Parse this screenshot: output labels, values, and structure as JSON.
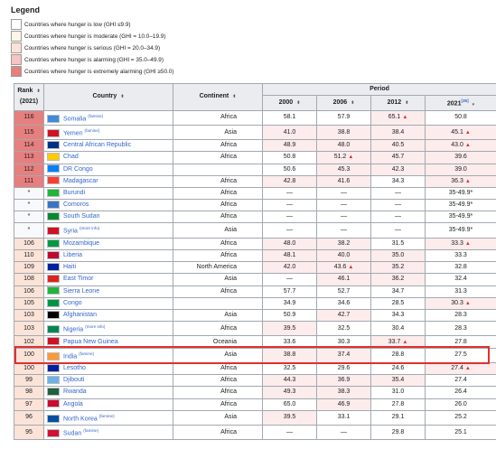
{
  "legend": {
    "title": "Legend",
    "items": [
      {
        "label": "Countries where hunger is low (GHI ≤9.9)",
        "color": "#ffffff"
      },
      {
        "label": "Countries where hunger is moderate (GHI = 10.0–19.9)",
        "color": "#fef5e7"
      },
      {
        "label": "Countries where hunger is serious (GHI = 20.0–34.9)",
        "color": "#fbe3d8"
      },
      {
        "label": "Countries where hunger is alarming (GHI = 35.0–49.9)",
        "color": "#f7c3c3"
      },
      {
        "label": "Countries where hunger is extremely alarming (GHI ≥50.0)",
        "color": "#e77f7f"
      }
    ]
  },
  "table": {
    "headers": {
      "rank": "Rank",
      "rank_year": "(2021)",
      "country": "Country",
      "continent": "Continent",
      "period": "Period",
      "years": [
        "2000",
        "2006",
        "2012",
        "2021"
      ],
      "ref": "[35]"
    },
    "rows": [
      {
        "rank": "116",
        "country": "Somalia",
        "sup": "(famine)",
        "continent": "Africa",
        "v": [
          "58.1",
          "57.9",
          "65.1",
          "50.8"
        ],
        "up": [
          false,
          false,
          true,
          false
        ],
        "flag": "#4189dd",
        "rank_bg": "#e77f7f"
      },
      {
        "rank": "115",
        "country": "Yemen",
        "sup": "(famine)",
        "continent": "Asia",
        "v": [
          "41.0",
          "38.8",
          "38.4",
          "45.1"
        ],
        "up": [
          false,
          false,
          false,
          true
        ],
        "flag": "#ce1126",
        "rank_bg": "#e77f7f"
      },
      {
        "rank": "114",
        "country": "Central African Republic",
        "sup": "",
        "continent": "Africa",
        "v": [
          "48.9",
          "48.0",
          "40.5",
          "43.0"
        ],
        "up": [
          false,
          false,
          false,
          true
        ],
        "flag": "#003082",
        "rank_bg": "#e77f7f"
      },
      {
        "rank": "113",
        "country": "Chad",
        "sup": "",
        "continent": "Africa",
        "v": [
          "50.8",
          "51.2",
          "45.7",
          "39.6"
        ],
        "up": [
          false,
          true,
          false,
          false
        ],
        "flag": "#fecb00",
        "rank_bg": "#e77f7f"
      },
      {
        "rank": "112",
        "country": "DR Congo",
        "sup": "",
        "continent": "",
        "v": [
          "50.6",
          "45.3",
          "42.3",
          "39.0"
        ],
        "up": [
          false,
          false,
          false,
          false
        ],
        "flag": "#007fff",
        "rank_bg": "#e77f7f"
      },
      {
        "rank": "111",
        "country": "Madagascar",
        "sup": "",
        "continent": "Africa",
        "v": [
          "42.8",
          "41.6",
          "34.3",
          "36.3"
        ],
        "up": [
          false,
          false,
          false,
          true
        ],
        "flag": "#fc3d32",
        "rank_bg": "#e77f7f"
      },
      {
        "rank": "*",
        "country": "Burundi",
        "sup": "",
        "continent": "Africa",
        "v": [
          "—",
          "—",
          "—",
          "35-49.9*"
        ],
        "up": [
          false,
          false,
          false,
          false
        ],
        "flag": "#1eb53a",
        "rank_bg": "#f8f9fa"
      },
      {
        "rank": "*",
        "country": "Comoros",
        "sup": "",
        "continent": "Africa",
        "v": [
          "—",
          "—",
          "—",
          "35-49.9*"
        ],
        "up": [
          false,
          false,
          false,
          false
        ],
        "flag": "#3a75c4",
        "rank_bg": "#f8f9fa"
      },
      {
        "rank": "*",
        "country": "South Sudan",
        "sup": "",
        "continent": "Africa",
        "v": [
          "—",
          "—",
          "—",
          "35-49.9*"
        ],
        "up": [
          false,
          false,
          false,
          false
        ],
        "flag": "#078930",
        "rank_bg": "#f8f9fa"
      },
      {
        "rank": "*",
        "country": "Syria",
        "sup": "(more info)",
        "continent": "Asia",
        "v": [
          "—",
          "—",
          "—",
          "35-49.9*"
        ],
        "up": [
          false,
          false,
          false,
          false
        ],
        "flag": "#ce1126",
        "rank_bg": "#f8f9fa"
      },
      {
        "rank": "106",
        "country": "Mozambique",
        "sup": "",
        "continent": "Africa",
        "v": [
          "48.0",
          "38.2",
          "31.5",
          "33.3"
        ],
        "up": [
          false,
          false,
          false,
          true
        ],
        "flag": "#009a44",
        "rank_bg": "#fbe3d8"
      },
      {
        "rank": "110",
        "country": "Liberia",
        "sup": "",
        "continent": "Africa",
        "v": [
          "48.1",
          "40.0",
          "35.0",
          "33.3"
        ],
        "up": [
          false,
          false,
          false,
          false
        ],
        "flag": "#bf0a30",
        "rank_bg": "#fbe3d8"
      },
      {
        "rank": "109",
        "country": "Haiti",
        "sup": "",
        "continent": "North America",
        "v": [
          "42.0",
          "43.6",
          "35.2",
          "32.8"
        ],
        "up": [
          false,
          true,
          false,
          false
        ],
        "flag": "#00209f",
        "rank_bg": "#fbe3d8"
      },
      {
        "rank": "108",
        "country": "East Timor",
        "sup": "",
        "continent": "Asia",
        "v": [
          "—",
          "46.1",
          "36.2",
          "32.4"
        ],
        "up": [
          false,
          false,
          false,
          false
        ],
        "flag": "#dc241f",
        "rank_bg": "#fbe3d8"
      },
      {
        "rank": "106",
        "country": "Sierra Leone",
        "sup": "",
        "continent": "Africa",
        "v": [
          "57.7",
          "52.7",
          "34.7",
          "31.3"
        ],
        "up": [
          false,
          false,
          false,
          false
        ],
        "flag": "#1eb53a",
        "rank_bg": "#fbe3d8"
      },
      {
        "rank": "105",
        "country": "Congo",
        "sup": "",
        "continent": "",
        "v": [
          "34.9",
          "34.6",
          "28.5",
          "30.3"
        ],
        "up": [
          false,
          false,
          false,
          true
        ],
        "flag": "#009543",
        "rank_bg": "#fbe3d8"
      },
      {
        "rank": "103",
        "country": "Afghanistan",
        "sup": "",
        "continent": "Asia",
        "v": [
          "50.9",
          "42.7",
          "34.3",
          "28.3"
        ],
        "up": [
          false,
          false,
          false,
          false
        ],
        "flag": "#000000",
        "rank_bg": "#fbe3d8"
      },
      {
        "rank": "103",
        "country": "Nigeria",
        "sup": "(more info)",
        "continent": "Africa",
        "v": [
          "39.5",
          "32.5",
          "30.4",
          "28.3"
        ],
        "up": [
          false,
          false,
          false,
          false
        ],
        "flag": "#008751",
        "rank_bg": "#fbe3d8"
      },
      {
        "rank": "102",
        "country": "Papua New Guinea",
        "sup": "",
        "continent": "Oceania",
        "v": [
          "33.6",
          "30.3",
          "33.7",
          "27.8"
        ],
        "up": [
          false,
          false,
          true,
          false
        ],
        "flag": "#ce1126",
        "rank_bg": "#fbe3d8"
      },
      {
        "rank": "100",
        "country": "India",
        "sup": "(famine)",
        "continent": "Asia",
        "v": [
          "38.8",
          "37.4",
          "28.8",
          "27.5"
        ],
        "up": [
          false,
          false,
          false,
          false
        ],
        "flag": "#ff9933",
        "rank_bg": "#fbe3d8"
      },
      {
        "rank": "100",
        "country": "Lesotho",
        "sup": "",
        "continent": "Africa",
        "v": [
          "32.5",
          "29.6",
          "24.6",
          "27.4"
        ],
        "up": [
          false,
          false,
          false,
          true
        ],
        "flag": "#00209f",
        "rank_bg": "#fbe3d8"
      },
      {
        "rank": "99",
        "country": "Djibouti",
        "sup": "",
        "continent": "Africa",
        "v": [
          "44.3",
          "36.9",
          "35.4",
          "27.4"
        ],
        "up": [
          false,
          false,
          false,
          false
        ],
        "flag": "#6ab2e7",
        "rank_bg": "#fbe3d8"
      },
      {
        "rank": "98",
        "country": "Rwanda",
        "sup": "",
        "continent": "Africa",
        "v": [
          "49.3",
          "38.3",
          "31.0",
          "26.4"
        ],
        "up": [
          false,
          false,
          false,
          false
        ],
        "flag": "#20603d",
        "rank_bg": "#fbe3d8"
      },
      {
        "rank": "97",
        "country": "Angola",
        "sup": "",
        "continent": "Africa",
        "v": [
          "65.0",
          "46.9",
          "27.8",
          "26.0"
        ],
        "up": [
          false,
          false,
          false,
          false
        ],
        "flag": "#cc092f",
        "rank_bg": "#fbe3d8"
      },
      {
        "rank": "96",
        "country": "North Korea",
        "sup": "(famine)",
        "continent": "Asia",
        "v": [
          "39.5",
          "33.1",
          "29.1",
          "25.2"
        ],
        "up": [
          false,
          false,
          false,
          false
        ],
        "flag": "#024fa2",
        "rank_bg": "#fbe3d8"
      },
      {
        "rank": "95",
        "country": "Sudan",
        "sup": "(famine)",
        "continent": "Africa",
        "v": [
          "—",
          "—",
          "29.8",
          "25.1"
        ],
        "up": [
          false,
          false,
          false,
          false
        ],
        "flag": "#d21034",
        "rank_bg": "#fbe3d8"
      }
    ]
  },
  "highlight": {
    "country": "India",
    "color": "#e03030"
  }
}
